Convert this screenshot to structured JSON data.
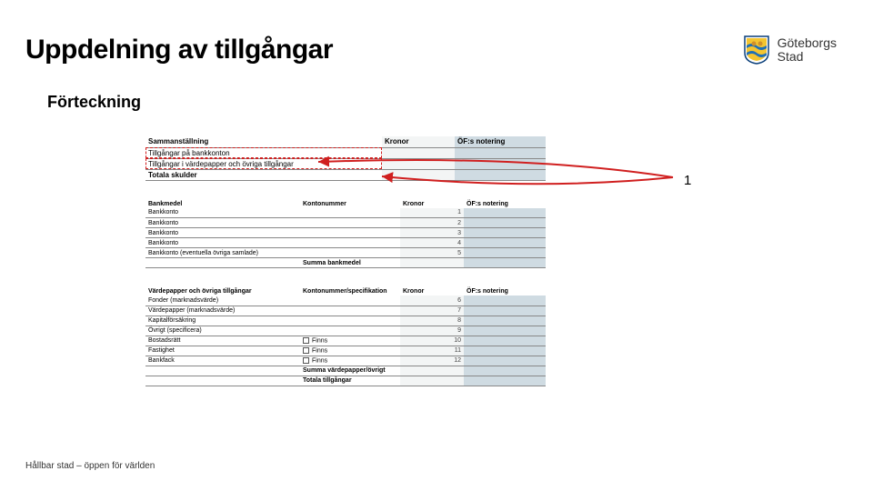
{
  "header": {
    "title": "Uppdelning av tillgångar",
    "logo_line1": "Göteborgs",
    "logo_line2": "Stad"
  },
  "subtitle": "Förteckning",
  "callout_1": "1",
  "summary": {
    "heading": "Sammanställning",
    "col_kr": "Kronor",
    "col_of": "ÖF:s notering",
    "rows": [
      "Tillgångar på bankkonton",
      "Tillgångar i värdepapper och övriga tillgångar",
      "Totala skulder"
    ]
  },
  "bank": {
    "heading": "Bankmedel",
    "col2": "Kontonummer",
    "col3": "Kronor",
    "col4": "ÖF:s notering",
    "rows": [
      {
        "label": "Bankkonto",
        "n": "1"
      },
      {
        "label": "Bankkonto",
        "n": "2"
      },
      {
        "label": "Bankkonto",
        "n": "3"
      },
      {
        "label": "Bankkonto",
        "n": "4"
      },
      {
        "label": "Bankkonto (eventuella övriga samlade)",
        "n": "5"
      }
    ],
    "sum_label": "Summa bankmedel"
  },
  "sec2": {
    "heading": "Värdepapper och övriga tillgångar",
    "col2": "Kontonummer/specifikation",
    "col3": "Kronor",
    "col4": "ÖF:s notering",
    "rows": [
      {
        "label": "Fonder (marknadsvärde)",
        "n": "6"
      },
      {
        "label": "Värdepapper (marknadsvärde)",
        "n": "7"
      },
      {
        "label": "Kapitalförsäkring",
        "n": "8"
      },
      {
        "label": "Övrigt (specificera)",
        "n": "9"
      }
    ],
    "bostad_label": "Bostadsrätt",
    "bostad_chk": "Finns",
    "bostad_n": "10",
    "fastighet_label": "Fastighet",
    "fastighet_chk": "Finns",
    "fastighet_n": "11",
    "bankfack_label": "Bankfack",
    "bankfack_chk": "Finns",
    "bankfack_n": "12",
    "sum_label": "Summa värdepapper/övrigt",
    "total_label": "Totala tillgångar"
  },
  "footer": "Hållbar stad – öppen för världen"
}
